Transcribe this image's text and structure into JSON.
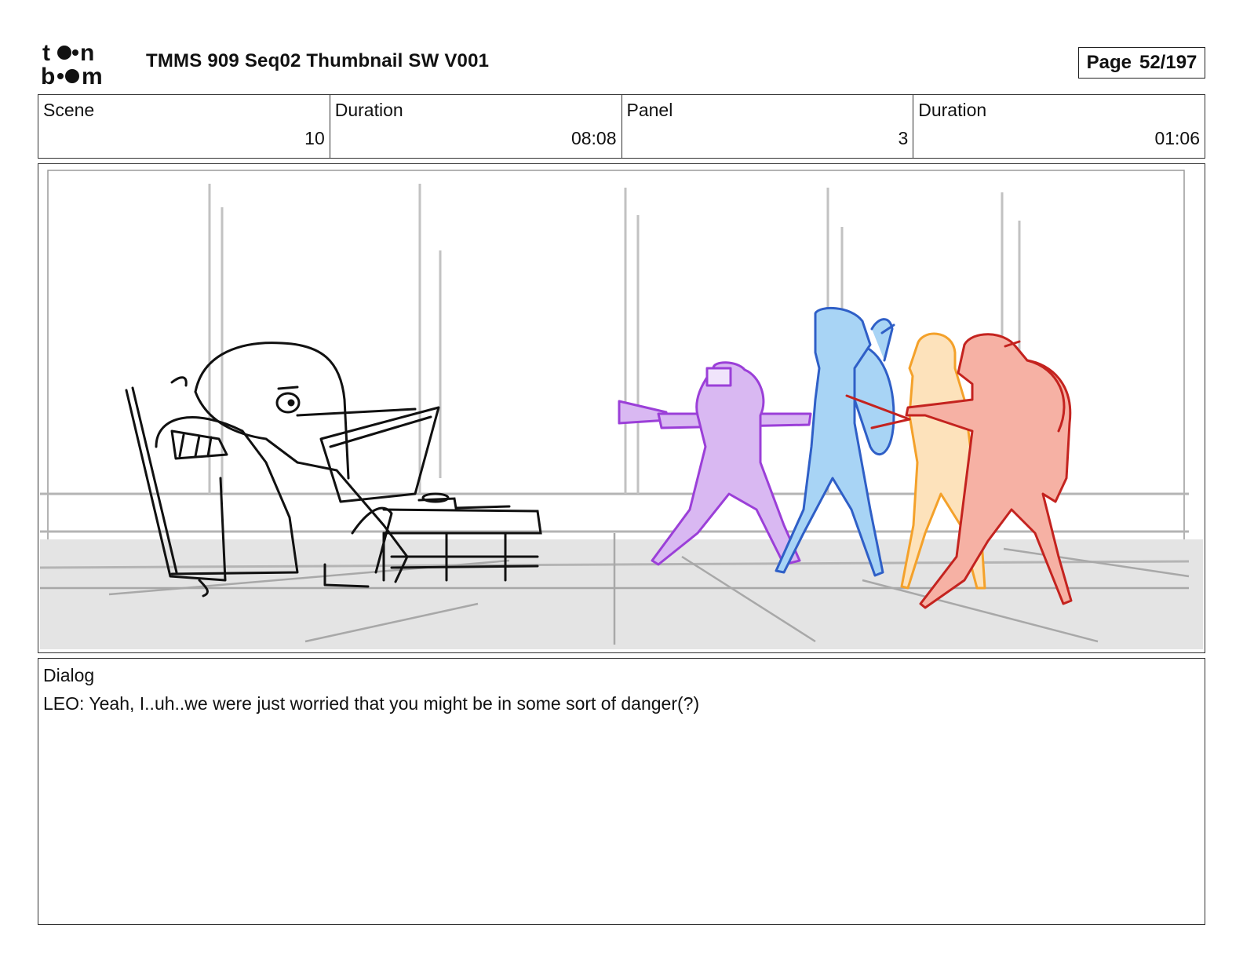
{
  "header": {
    "logo_text": "toon boom",
    "title": "TMMS 909 Seq02 Thumbnail SW V001",
    "page_label": "Page",
    "page_value": "52/197"
  },
  "info": {
    "scene_label": "Scene",
    "scene_value": "10",
    "scene_duration_label": "Duration",
    "scene_duration_value": "08:08",
    "panel_label": "Panel",
    "panel_value": "3",
    "panel_duration_label": "Duration",
    "panel_duration_value": "01:06"
  },
  "dialog": {
    "label": "Dialog",
    "text": "LEO: Yeah, I..uh..we were just worried that you might be in some sort of danger(?)"
  },
  "colors": {
    "purple_character": "#9b3fd8",
    "blue_character": "#2f5fc7",
    "orange_character": "#f4a12a",
    "red_character": "#c4231f",
    "sketch_gray": "#bdbdbd"
  }
}
